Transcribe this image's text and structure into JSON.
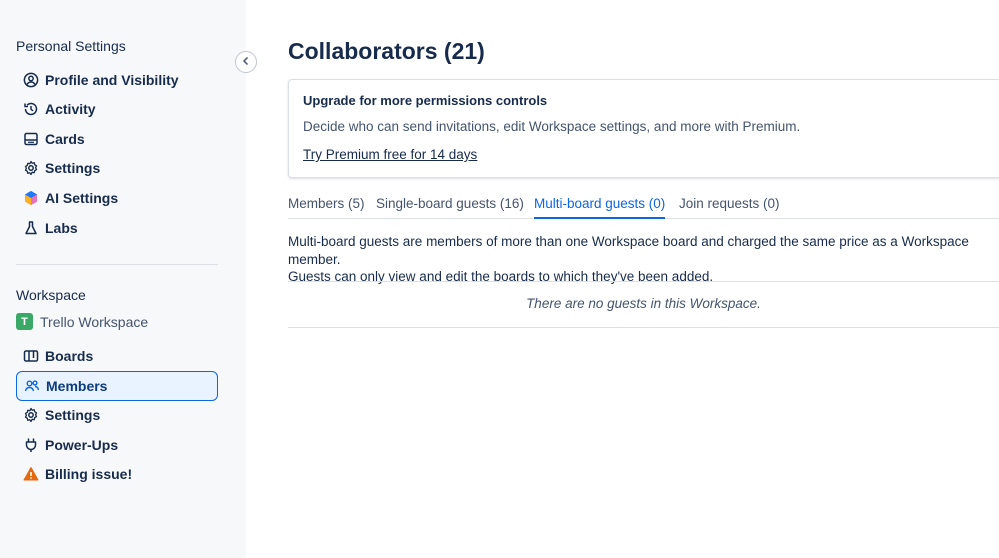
{
  "sidebar": {
    "personal_heading": "Personal Settings",
    "personal_items": [
      {
        "label": "Profile and Visibility",
        "icon": "profile-icon"
      },
      {
        "label": "Activity",
        "icon": "history-icon"
      },
      {
        "label": "Cards",
        "icon": "card-icon"
      },
      {
        "label": "Settings",
        "icon": "gear-icon"
      },
      {
        "label": "AI Settings",
        "icon": "ai-icon"
      },
      {
        "label": "Labs",
        "icon": "flask-icon"
      }
    ],
    "workspace_heading": "Workspace",
    "workspace_name": "Trello Workspace",
    "workspace_logo_letter": "T",
    "workspace_items": [
      {
        "label": "Boards",
        "icon": "boards-icon"
      },
      {
        "label": "Members",
        "icon": "members-icon",
        "active": true
      },
      {
        "label": "Settings",
        "icon": "gear-icon"
      },
      {
        "label": "Power-Ups",
        "icon": "plug-icon"
      },
      {
        "label": "Billing issue!",
        "icon": "warning-icon"
      }
    ]
  },
  "main": {
    "title": "Collaborators (21)",
    "upgrade": {
      "title": "Upgrade for more permissions controls",
      "description": "Decide who can send invitations, edit Workspace settings, and more with Premium.",
      "link": "Try Premium free for 14 days"
    },
    "tabs": [
      {
        "label": "Members (5)"
      },
      {
        "label": "Single-board guests (16)"
      },
      {
        "label": "Multi-board guests (0)",
        "active": true
      },
      {
        "label": "Join requests (0)"
      }
    ],
    "description_line1": "Multi-board guests are members of more than one Workspace board and charged the same price as a Workspace member.",
    "description_line2": "Guests can only view and edit the boards to which they've been added.",
    "empty_message": "There are no guests in this Workspace."
  },
  "colors": {
    "accent": "#0c66e4",
    "sidebar_bg": "#f7f8f9",
    "workspace_logo": "#3aa866",
    "warning": "#e56910"
  }
}
